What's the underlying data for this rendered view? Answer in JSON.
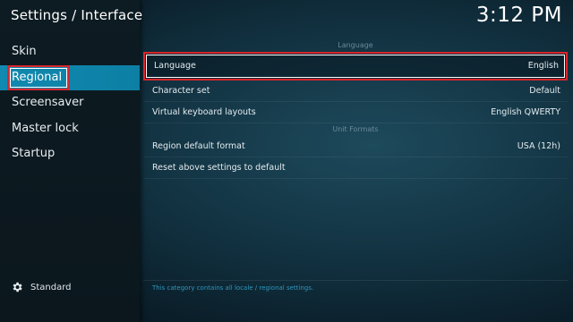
{
  "header": {
    "title": "Settings / Interface",
    "clock": "3:12 PM"
  },
  "sidebar": {
    "items": [
      {
        "label": "Skin"
      },
      {
        "label": "Regional"
      },
      {
        "label": "Screensaver"
      },
      {
        "label": "Master lock"
      },
      {
        "label": "Startup"
      }
    ],
    "active_index": 1,
    "settings_level": "Standard"
  },
  "content": {
    "group_language": "Language",
    "rows_language": [
      {
        "label": "Language",
        "value": "English"
      },
      {
        "label": "Character set",
        "value": "Default"
      },
      {
        "label": "Virtual keyboard layouts",
        "value": "English QWERTY"
      }
    ],
    "group_units": "Unit Formats",
    "rows_units": [
      {
        "label": "Region default format",
        "value": "USA (12h)"
      }
    ],
    "reset_label": "Reset above settings to default"
  },
  "footer": {
    "hint": "This category contains all locale / regional settings."
  },
  "colors": {
    "accent": "#1189b0",
    "focus": "#d8262d",
    "hint": "#2e97bd"
  },
  "icons": {
    "settings_level": "gear-icon"
  }
}
